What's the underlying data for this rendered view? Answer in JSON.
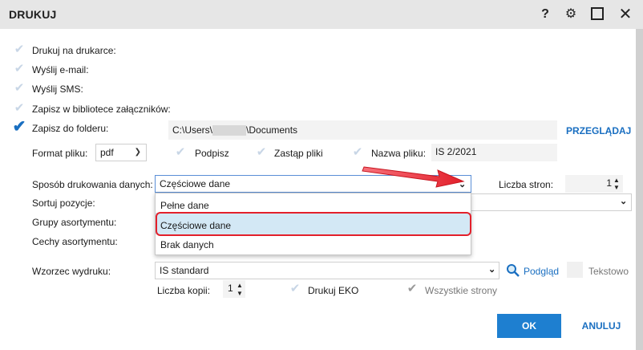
{
  "window": {
    "title": "DRUKUJ",
    "help_icon": "?",
    "settings_icon": "gear-icon",
    "maximize_icon": "square-icon",
    "close_icon": "close-icon"
  },
  "options": {
    "print_printer": "Drukuj na drukarce:",
    "send_email": "Wyślij e-mail:",
    "send_sms": "Wyślij SMS:",
    "save_library": "Zapisz w bibliotece załączników:",
    "save_folder": "Zapisz do folderu:"
  },
  "folder": {
    "path_prefix": "C:\\Users\\",
    "path_suffix": "\\Documents",
    "browse_label": "PRZEGLĄDAJ"
  },
  "file_format": {
    "label": "Format pliku:",
    "value": "pdf",
    "sign_label": "Podpisz",
    "replace_label": "Zastąp pliki",
    "filename_label": "Nazwa pliku:",
    "filename_value": "IS 2/2021"
  },
  "print_mode": {
    "label": "Sposób drukowania danych:",
    "value": "Częściowe dane",
    "options": [
      "Pełne dane",
      "Częściowe dane",
      "Brak danych"
    ],
    "selected_index": 1
  },
  "pages": {
    "label": "Liczba stron:",
    "value": "1"
  },
  "sort": {
    "label": "Sortuj pozycje:"
  },
  "groups": {
    "label": "Grupy asortymentu:"
  },
  "features": {
    "label": "Cechy asortymentu:"
  },
  "template": {
    "label": "Wzorzec wydruku:",
    "value": "IS standard",
    "preview_label": "Podgląd",
    "text_label": "Tekstowo"
  },
  "copies": {
    "label": "Liczba kopii:",
    "value": "1",
    "eko_label": "Drukuj EKO",
    "all_pages_label": "Wszystkie strony"
  },
  "buttons": {
    "ok": "OK",
    "cancel": "ANULUJ"
  },
  "colors": {
    "accent": "#1e7fd0",
    "highlight": "#d3e8f5",
    "annotation_red": "#e3202b"
  }
}
